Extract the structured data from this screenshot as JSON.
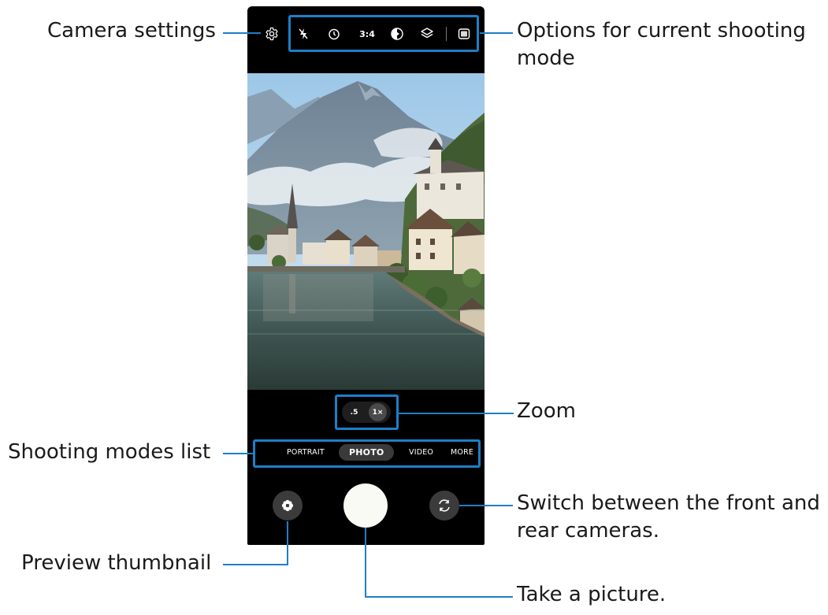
{
  "callouts": {
    "camera_settings": "Camera settings",
    "options_line1": "Options for current shooting",
    "options_line2": "mode",
    "zoom": "Zoom",
    "shooting_modes_list": "Shooting modes list",
    "switch_line1": "Switch between the front and",
    "switch_line2": "rear cameras.",
    "preview_thumbnail": "Preview thumbnail",
    "take_picture": "Take a picture."
  },
  "options_bar": {
    "icons": [
      "flash-off-icon",
      "timer-icon",
      "aspect-ratio",
      "motion-photo-icon",
      "filter-icon",
      "more-options-icon"
    ],
    "ratio_label": "3:4"
  },
  "zoom": {
    "options": [
      ".5",
      "1×"
    ],
    "selected": "1×"
  },
  "modes": {
    "items": [
      "PORTRAIT",
      "PHOTO",
      "VIDEO",
      "MORE"
    ],
    "active": "PHOTO"
  },
  "colors": {
    "accent": "#1d7fc8",
    "phone": "#000000",
    "shutter": "#fafaf5"
  }
}
